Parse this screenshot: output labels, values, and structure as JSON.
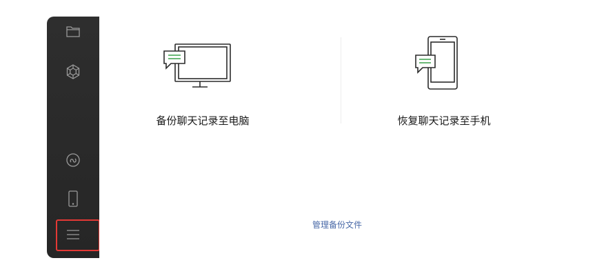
{
  "sidebar": {
    "items": [
      {
        "icon": "folder-icon"
      },
      {
        "icon": "mini-program-icon"
      },
      {
        "icon": "channels-icon"
      },
      {
        "icon": "phone-icon"
      },
      {
        "icon": "menu-icon"
      }
    ],
    "highlight_color": "#e53935"
  },
  "main": {
    "backup_label": "备份聊天记录至电脑",
    "restore_label": "恢复聊天记录至手机",
    "manage_link": "管理备份文件"
  },
  "colors": {
    "sidebar_bg": "#2e2e2e",
    "icon_stroke": "#9a9a9a",
    "bubble_green": "#3aa24a",
    "link": "#4a6aa8"
  }
}
